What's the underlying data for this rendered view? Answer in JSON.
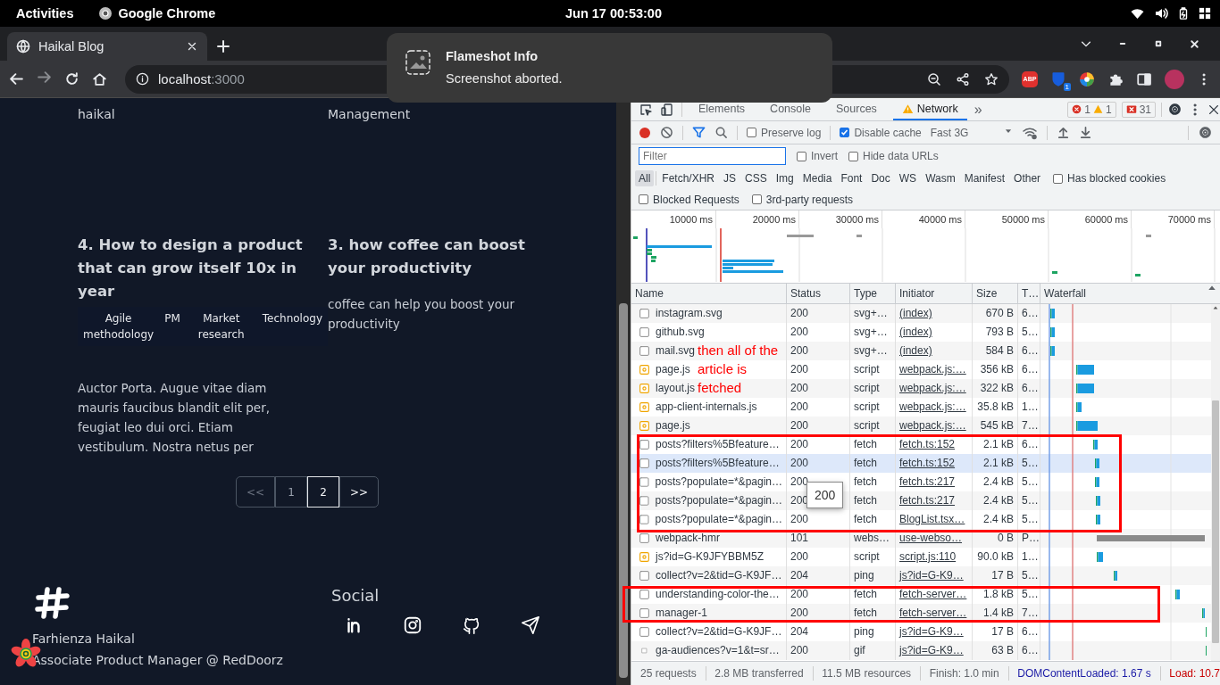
{
  "topbar": {
    "activities": "Activities",
    "app": "Google Chrome",
    "clock": "Jun 17  00:53:00"
  },
  "browser": {
    "tab_title": "Haikal Blog",
    "url_host": "localhost",
    "url_port": ":3000",
    "extensions": [
      {
        "kind": "abp",
        "label": "ABP"
      },
      {
        "kind": "shield",
        "badge": "1"
      },
      {
        "kind": "wheel"
      },
      {
        "kind": "puzzle"
      },
      {
        "kind": "panel"
      },
      {
        "kind": "avatar"
      }
    ]
  },
  "notification": {
    "title": "Flameshot Info",
    "body": "Screenshot aborted."
  },
  "page": {
    "top_texts": [
      "haikal",
      "Management"
    ],
    "articles": [
      {
        "title": "4. How to design a product that can grow itself 10x in year",
        "tags": [
          "Agile methodology",
          "PM",
          "Market research",
          "Technology"
        ],
        "excerpt": "Auctor Porta. Augue vitae diam mauris faucibus blandit elit per, feugiat leo dui orci. Etiam vestibulum. Nostra netus per"
      },
      {
        "title": "3. how coffee can boost your productivity",
        "excerpt": "coffee can help you boost your productivity"
      }
    ],
    "pagination": [
      {
        "label": "<<",
        "selected": false,
        "disabled": true
      },
      {
        "label": "1",
        "selected": false,
        "disabled": false
      },
      {
        "label": "2",
        "selected": true,
        "disabled": false
      },
      {
        "label": ">>",
        "selected": false,
        "disabled": false
      }
    ],
    "footer": {
      "name": "Farhienza Haikal",
      "role": "Associate Product Manager @ RedDoorz",
      "social_title": "Social",
      "social": [
        {
          "kind": "linkedin"
        },
        {
          "kind": "instagram"
        },
        {
          "kind": "github"
        },
        {
          "kind": "send"
        }
      ]
    }
  },
  "devtools": {
    "tabs": [
      {
        "label": "Elements",
        "selected": false,
        "warning": false
      },
      {
        "label": "Console",
        "selected": false,
        "warning": false
      },
      {
        "label": "Sources",
        "selected": false,
        "warning": false
      },
      {
        "label": "Network",
        "selected": true,
        "warning": true
      }
    ],
    "more": "»",
    "counts": [
      {
        "kind": "error",
        "count": "1"
      },
      {
        "kind": "warning",
        "count": "1"
      },
      {
        "kind": "issues",
        "count": "31"
      }
    ],
    "toolbar": {
      "recording": true,
      "filter_on": true,
      "preserve_log": {
        "label": "Preserve log",
        "checked": false
      },
      "disable_cache": {
        "label": "Disable cache",
        "checked": true
      },
      "throttling": "Fast 3G"
    },
    "filter": {
      "placeholder": "Filter",
      "options": [
        {
          "label": "Invert",
          "checked": false
        },
        {
          "label": "Hide data URLs",
          "checked": false
        }
      ]
    },
    "types": [
      {
        "label": "All",
        "selected": true
      },
      {
        "label": "Fetch/XHR",
        "selected": false
      },
      {
        "label": "JS",
        "selected": false
      },
      {
        "label": "CSS",
        "selected": false
      },
      {
        "label": "Img",
        "selected": false
      },
      {
        "label": "Media",
        "selected": false
      },
      {
        "label": "Font",
        "selected": false
      },
      {
        "label": "Doc",
        "selected": false
      },
      {
        "label": "WS",
        "selected": false
      },
      {
        "label": "Wasm",
        "selected": false
      },
      {
        "label": "Manifest",
        "selected": false
      },
      {
        "label": "Other",
        "selected": false
      }
    ],
    "type_options": [
      {
        "label": "Has blocked cookies",
        "checked": false
      }
    ],
    "request_options": [
      {
        "label": "Blocked Requests",
        "checked": false
      },
      {
        "label": "3rd-party requests",
        "checked": false
      }
    ],
    "overview": {
      "ticks": [
        "10000 ms",
        "20000 ms",
        "30000 ms",
        "40000 ms",
        "50000 ms",
        "60000 ms",
        "70000 ms"
      ]
    },
    "table": {
      "columns": [
        "Name",
        "Status",
        "Type",
        "Initiator",
        "Size",
        "T…",
        "Waterfall"
      ],
      "rows": [
        {
          "kind": "plain",
          "name": "instagram.svg",
          "status": "200",
          "type": "svg+…",
          "initiator": "(index)",
          "size": "670 B",
          "time": "6…",
          "selected": false
        },
        {
          "kind": "plain",
          "name": "github.svg",
          "status": "200",
          "type": "svg+…",
          "initiator": "(index)",
          "size": "793 B",
          "time": "5…",
          "selected": false
        },
        {
          "kind": "plain",
          "name": "mail.svg",
          "status": "200",
          "type": "svg+…",
          "initiator": "(index)",
          "size": "584 B",
          "time": "6…",
          "selected": false
        },
        {
          "kind": "code",
          "name": "page.js",
          "status": "200",
          "type": "script",
          "initiator": "webpack.js:…",
          "size": "356 kB",
          "time": "6…",
          "selected": false
        },
        {
          "kind": "code",
          "name": "layout.js",
          "status": "200",
          "type": "script",
          "initiator": "webpack.js:…",
          "size": "322 kB",
          "time": "6…",
          "selected": false
        },
        {
          "kind": "code",
          "name": "app-client-internals.js",
          "status": "200",
          "type": "script",
          "initiator": "webpack.js:…",
          "size": "35.8 kB",
          "time": "1…",
          "selected": false
        },
        {
          "kind": "code",
          "name": "page.js",
          "status": "200",
          "type": "script",
          "initiator": "webpack.js:…",
          "size": "545 kB",
          "time": "7…",
          "selected": false
        },
        {
          "kind": "plain",
          "name": "posts?filters%5Bfeature…",
          "status": "200",
          "type": "fetch",
          "initiator": "fetch.ts:152",
          "size": "2.1 kB",
          "time": "6…",
          "selected": false
        },
        {
          "kind": "plain",
          "name": "posts?filters%5Bfeature…",
          "status": "200",
          "type": "fetch",
          "initiator": "fetch.ts:152",
          "size": "2.1 kB",
          "time": "5…",
          "selected": true
        },
        {
          "kind": "plain",
          "name": "posts?populate=*&pagin…",
          "status": "200",
          "type": "fetch",
          "initiator": "fetch.ts:217",
          "size": "2.4 kB",
          "time": "5…",
          "selected": false
        },
        {
          "kind": "plain",
          "name": "posts?populate=*&pagin…",
          "status": "200",
          "type": "fetch",
          "initiator": "fetch.ts:217",
          "size": "2.4 kB",
          "time": "5…",
          "selected": false
        },
        {
          "kind": "plain",
          "name": "posts?populate=*&pagin…",
          "status": "200",
          "type": "fetch",
          "initiator": "BlogList.tsx…",
          "size": "2.4 kB",
          "time": "5…",
          "selected": false
        },
        {
          "kind": "plain",
          "name": "webpack-hmr",
          "status": "101",
          "type": "webs…",
          "initiator": "use-webso…",
          "size": "0 B",
          "time": "P…",
          "selected": false
        },
        {
          "kind": "code",
          "name": "js?id=G-K9JFYBBM5Z",
          "status": "200",
          "type": "script",
          "initiator": "script.js:110",
          "size": "90.0 kB",
          "time": "1…",
          "selected": false
        },
        {
          "kind": "plain",
          "name": "collect?v=2&tid=G-K9JF…",
          "status": "204",
          "type": "ping",
          "initiator": "js?id=G-K9…",
          "size": "17 B",
          "time": "5…",
          "selected": false
        },
        {
          "kind": "plain",
          "name": "understanding-color-the…",
          "status": "200",
          "type": "fetch",
          "initiator": "fetch-server…",
          "size": "1.8 kB",
          "time": "5…",
          "selected": false
        },
        {
          "kind": "plain",
          "name": "manager-1",
          "status": "200",
          "type": "fetch",
          "initiator": "fetch-server…",
          "size": "1.4 kB",
          "time": "7…",
          "selected": false
        },
        {
          "kind": "plain",
          "name": "collect?v=2&tid=G-K9JF…",
          "status": "204",
          "type": "ping",
          "initiator": "js?id=G-K9…",
          "size": "17 B",
          "time": "6…",
          "selected": false
        },
        {
          "kind": "small",
          "name": "ga-audiences?v=1&t=sr…",
          "status": "200",
          "type": "gif",
          "initiator": "js?id=G-K9…",
          "size": "63 B",
          "time": "6…",
          "selected": false
        }
      ]
    },
    "status": [
      {
        "kind": "plain",
        "text": "25 requests"
      },
      {
        "kind": "plain",
        "text": "2.8 MB transferred"
      },
      {
        "kind": "plain",
        "text": "11.5 MB resources"
      },
      {
        "kind": "plain",
        "text": "Finish: 1.0 min"
      },
      {
        "kind": "dcl",
        "text": "DOMContentLoaded: 1.67 s"
      },
      {
        "kind": "load",
        "text": "Load: 10.7"
      }
    ],
    "tooltip": "200"
  },
  "annotation": {
    "text": "then all of the article is fetched"
  }
}
